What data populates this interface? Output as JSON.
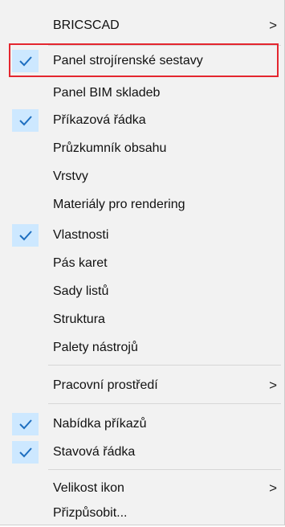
{
  "menu": {
    "items": [
      {
        "label": "BRICSCAD",
        "checked": false,
        "submenu": true
      },
      {
        "label": "Panel strojírenské sestavy",
        "checked": true,
        "submenu": false
      },
      {
        "label": "Panel BIM skladeb",
        "checked": false,
        "submenu": false
      },
      {
        "label": "Příkazová řádka",
        "checked": true,
        "submenu": false
      },
      {
        "label": "Průzkumník obsahu",
        "checked": false,
        "submenu": false
      },
      {
        "label": "Vrstvy",
        "checked": false,
        "submenu": false
      },
      {
        "label": "Materiály pro rendering",
        "checked": false,
        "submenu": false
      },
      {
        "label": "Vlastnosti",
        "checked": true,
        "submenu": false
      },
      {
        "label": "Pás karet",
        "checked": false,
        "submenu": false
      },
      {
        "label": "Sady listů",
        "checked": false,
        "submenu": false
      },
      {
        "label": "Struktura",
        "checked": false,
        "submenu": false
      },
      {
        "label": "Palety nástrojů",
        "checked": false,
        "submenu": false
      },
      {
        "label": "Pracovní prostředí",
        "checked": false,
        "submenu": true
      },
      {
        "label": "Nabídka příkazů",
        "checked": true,
        "submenu": false
      },
      {
        "label": "Stavová řádka",
        "checked": true,
        "submenu": false
      },
      {
        "label": "Velikost ikon",
        "checked": false,
        "submenu": true
      },
      {
        "label": "Přizpůsobit...",
        "checked": false,
        "submenu": false
      }
    ],
    "submenu_arrow": ">"
  },
  "colors": {
    "menu_bg": "#f2f2f2",
    "check_bg": "#cde8ff",
    "check_mark": "#1e6fc0",
    "highlight_border": "#e4262f"
  }
}
